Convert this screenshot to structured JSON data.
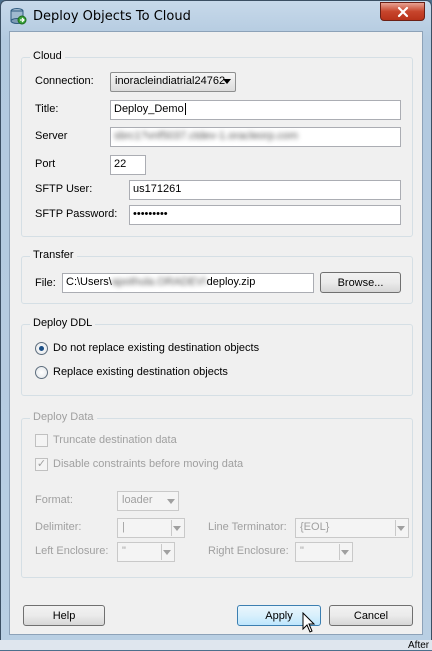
{
  "window": {
    "title": "Deploy Objects To Cloud"
  },
  "cloud": {
    "legend": "Cloud",
    "connection_label": "Connection:",
    "connection_value": "inoracleindiatrial24762",
    "title_label": "Title:",
    "title_value": "Deploy_Demo",
    "server_label": "Server",
    "server_value": "sbrc1?vnf5037.ctdev-1.oracleorp.com",
    "port_label": "Port",
    "port_value": "22",
    "sftp_user_label": "SFTP User:",
    "sftp_user_value": "us171261",
    "sftp_password_label": "SFTP Password:",
    "sftp_password_value": "•••••••••"
  },
  "transfer": {
    "legend": "Transfer",
    "file_label": "File:",
    "file_prefix": "C:\\Users\\",
    "file_blurred": "apothula.ORADEV\\",
    "file_suffix": "deploy.zip",
    "browse_label": "Browse..."
  },
  "deploy_ddl": {
    "legend": "Deploy DDL",
    "option1": "Do not replace existing destination objects",
    "option2": "Replace existing destination objects"
  },
  "deploy_data": {
    "legend": "Deploy Data",
    "truncate_label": "Truncate destination data",
    "disable_constraints_label": "Disable constraints before moving data",
    "format_label": "Format:",
    "format_value": "loader",
    "delimiter_label": "Delimiter:",
    "delimiter_value": "|",
    "line_terminator_label": "Line Terminator:",
    "line_terminator_value": "{EOL}",
    "left_enclosure_label": "Left Enclosure:",
    "left_enclosure_value": "\"",
    "right_enclosure_label": "Right Enclosure:",
    "right_enclosure_value": "\""
  },
  "buttons": {
    "help": "Help",
    "apply": "Apply",
    "cancel": "Cancel"
  },
  "background": {
    "after_text": "After"
  }
}
